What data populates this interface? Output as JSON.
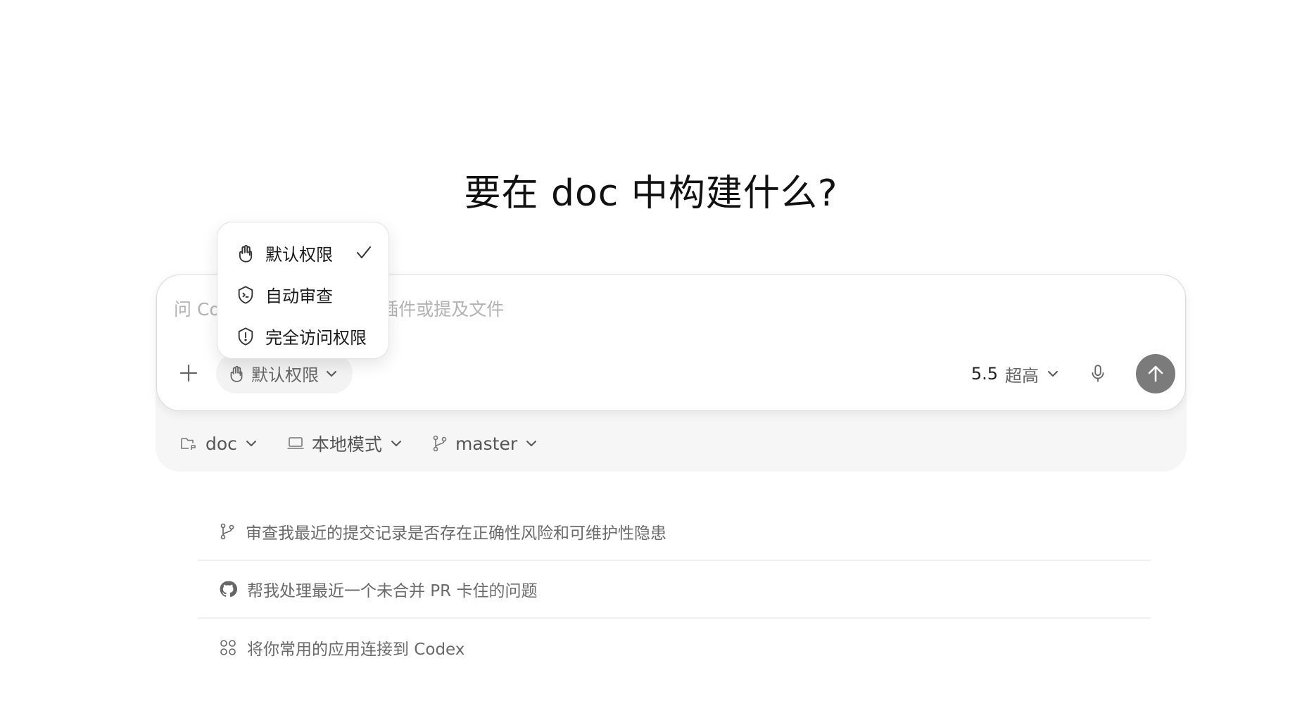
{
  "heading": "要在 doc 中构建什么?",
  "composer": {
    "placeholder": "问 Codex 任何问题，使用插件或提及文件",
    "value": "",
    "permission_label": "默认权限",
    "model_version": "5.5",
    "model_effort": "超高"
  },
  "context": {
    "folder": "doc",
    "mode": "本地模式",
    "branch": "master"
  },
  "permission_menu": {
    "items": [
      {
        "label": "默认权限",
        "icon": "hand-icon",
        "selected": true
      },
      {
        "label": "自动审查",
        "icon": "shield-terminal-icon",
        "selected": false
      },
      {
        "label": "完全访问权限",
        "icon": "shield-alert-icon",
        "selected": false
      }
    ]
  },
  "suggestions": [
    {
      "icon": "git-branch-icon",
      "text": "审查我最近的提交记录是否存在正确性风险和可维护性隐患"
    },
    {
      "icon": "github-icon",
      "text": "帮我处理最近一个未合并 PR 卡住的问题"
    },
    {
      "icon": "apps-grid-icon",
      "text": "将你常用的应用连接到 Codex"
    }
  ],
  "colors": {
    "send_button": "#7b7b7b",
    "panel_bg": "#f6f6f6",
    "muted_text": "#6a6a6a"
  }
}
